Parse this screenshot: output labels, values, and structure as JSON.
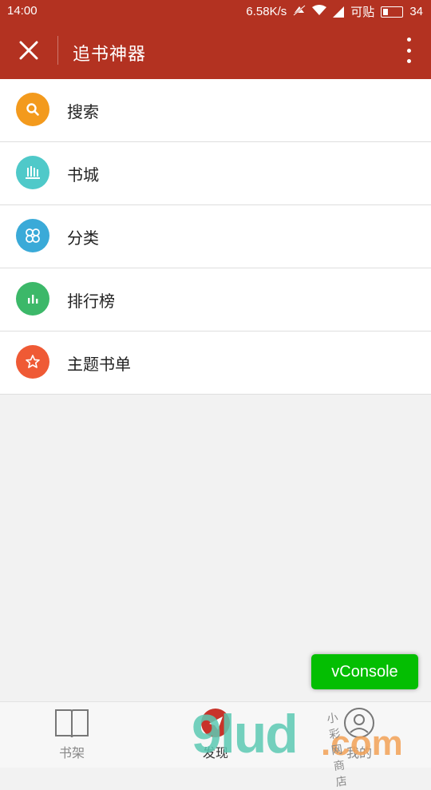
{
  "status_bar": {
    "time": "14:00",
    "speed": "6.58K/s",
    "carrier": "可贴",
    "battery": "34"
  },
  "app_bar": {
    "title": "追书神器"
  },
  "menu": [
    {
      "label": "搜索",
      "icon": "search-icon",
      "color": "#f39a1d"
    },
    {
      "label": "书城",
      "icon": "bookstore-icon",
      "color": "#4fc9c9"
    },
    {
      "label": "分类",
      "icon": "category-icon",
      "color": "#3aaad8"
    },
    {
      "label": "排行榜",
      "icon": "ranking-icon",
      "color": "#3cb869"
    },
    {
      "label": "主题书单",
      "icon": "star-icon",
      "color": "#ef5a35"
    }
  ],
  "vconsole": {
    "label": "vConsole"
  },
  "bottom_nav": [
    {
      "label": "书架",
      "icon": "bookshelf-icon"
    },
    {
      "label": "发现",
      "icon": "discover-icon"
    },
    {
      "label": "我的",
      "icon": "profile-icon"
    }
  ],
  "watermark": {
    "main": "9lud",
    "suffix": ".com",
    "small": "小彩网商店"
  },
  "colors": {
    "primary": "#b33221",
    "vconsole": "#04be02",
    "background": "#f2f2f2"
  }
}
